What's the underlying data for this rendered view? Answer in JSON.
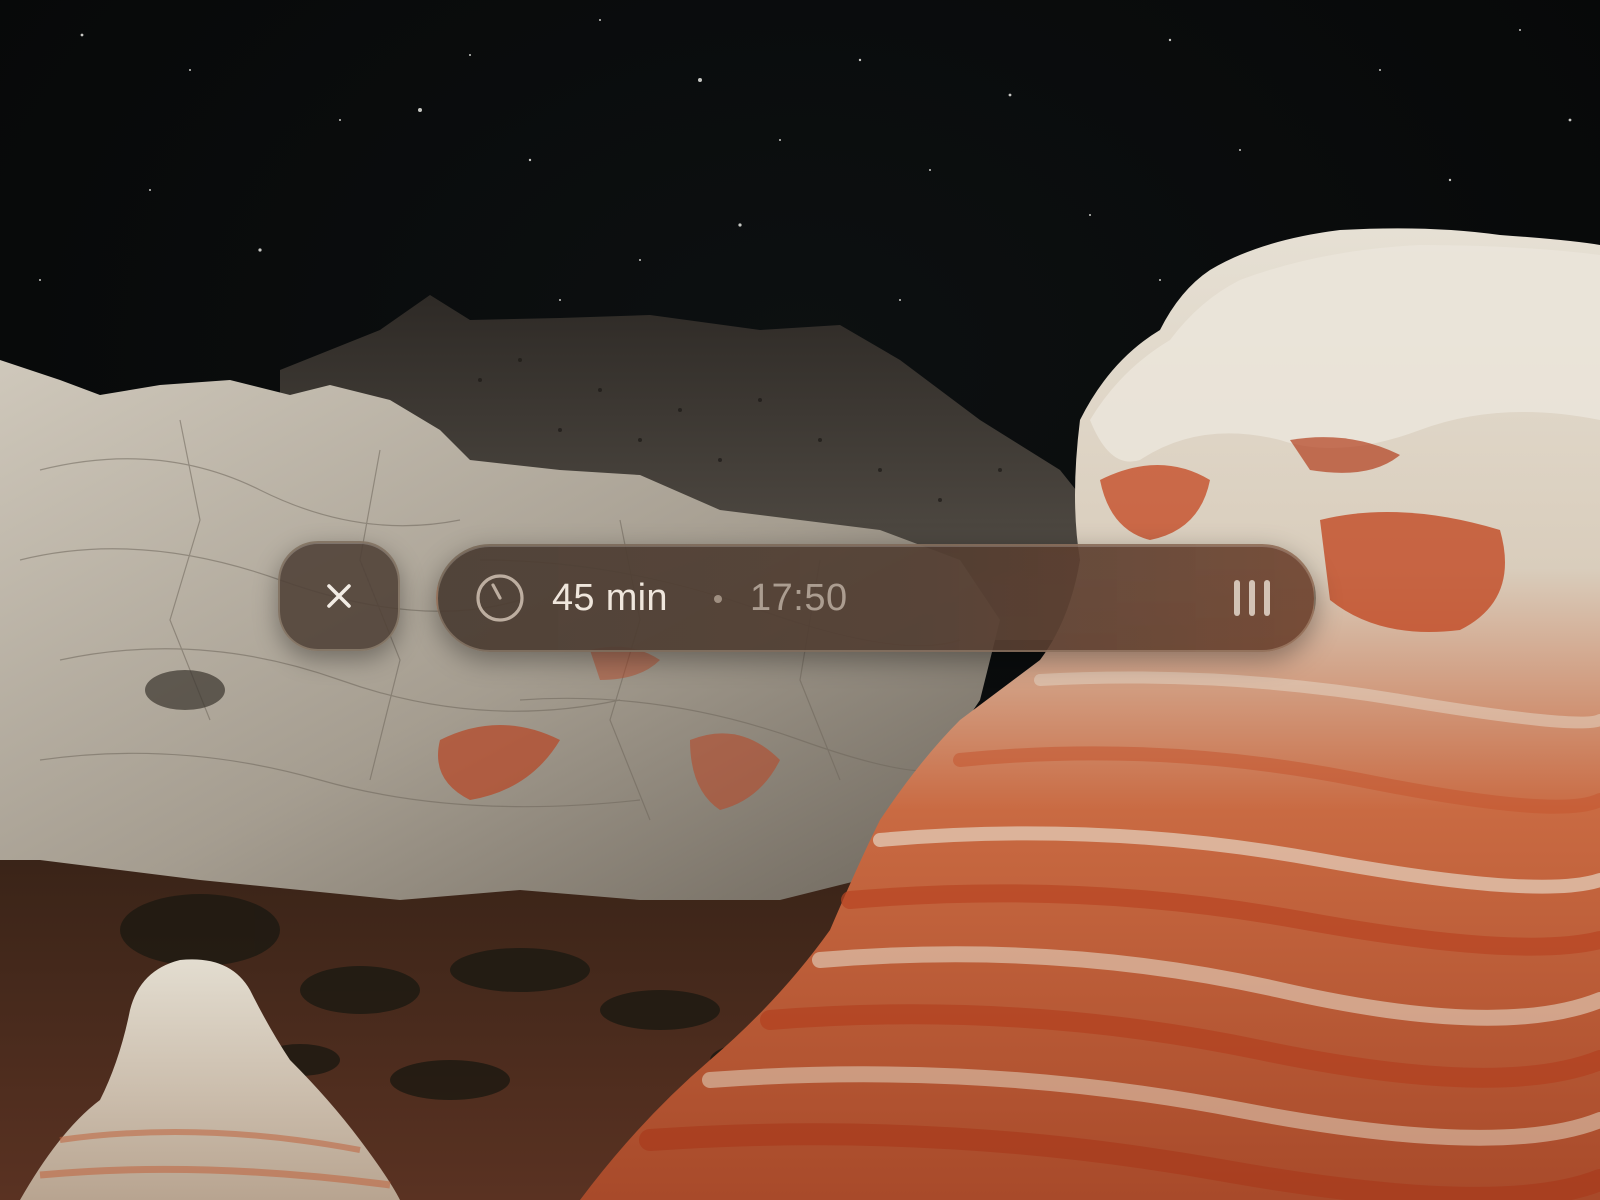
{
  "background": {
    "description_icon": "night-desert-rock-wallpaper",
    "sky_color": "#070809",
    "rock_white": "#d8d2c6",
    "rock_red": "#c8502a"
  },
  "close_button": {
    "icon": "close-icon"
  },
  "timer": {
    "icon": "timer-icon",
    "duration": "45 min",
    "separator_icon": "dot-separator",
    "end_time": "17:50",
    "menu_icon": "bars-icon"
  }
}
